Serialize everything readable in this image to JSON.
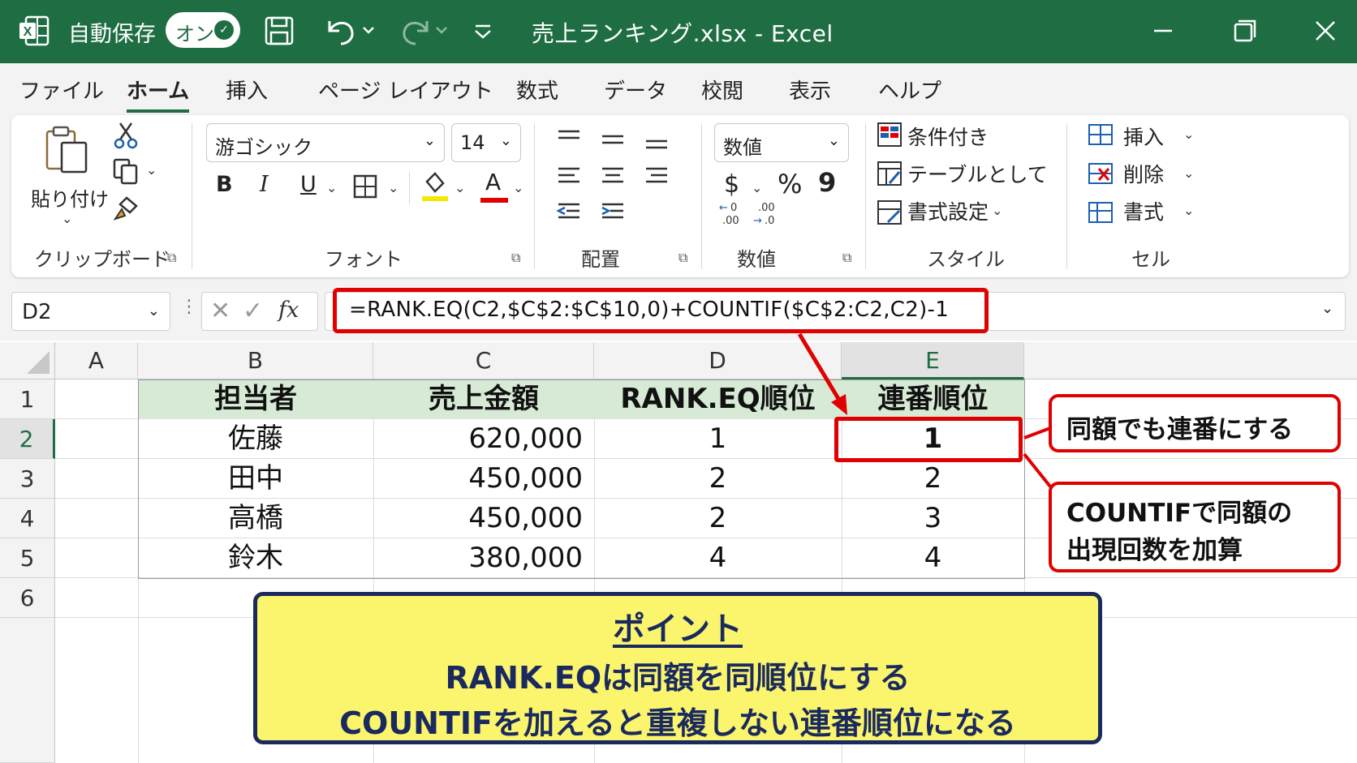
{
  "titlebar": {
    "autosave_label": "自動保存",
    "autosave_toggle": "オン",
    "document_title": "売上ランキング.xlsx  -  Excel",
    "accent_color": "#1f6e43"
  },
  "tabs": [
    "ファイル",
    "ホーム",
    "挿入",
    "ページ レイアウト",
    "数式",
    "データ",
    "校閲",
    "表示",
    "ヘルプ"
  ],
  "active_tab": "ホーム",
  "ribbon": {
    "clipboard": {
      "paste_label": "貼り付け",
      "group_label": "クリップボード"
    },
    "font": {
      "font_name": "游ゴシック",
      "font_size": "14",
      "bold": "B",
      "italic": "I",
      "underline": "U",
      "font_color_glyph": "A",
      "group_label": "フォント"
    },
    "alignment": {
      "group_label": "配置"
    },
    "number": {
      "format": "数値",
      "currency": "$",
      "percent": "%",
      "comma": "9",
      "inc_decimal": "←0\n.00",
      "dec_decimal": ".00\n→.0",
      "group_label": "数値"
    },
    "styles": {
      "conditional": "条件付き",
      "as_table": "テーブルとして",
      "cell_styles": "書式設定",
      "group_label": "スタイル"
    },
    "cells": {
      "insert": "挿入",
      "delete": "削除",
      "format": "書式",
      "group_label": "セル"
    }
  },
  "formula_bar": {
    "name_box": "D2",
    "fx": "fx",
    "formula": "=RANK.EQ(C2,$C$2:$C$10,0)+COUNTIF($C$2:C2,C2)-1"
  },
  "columns": [
    "A",
    "B",
    "C",
    "D",
    "E"
  ],
  "rows": [
    "1",
    "2",
    "3",
    "4",
    "5",
    "6"
  ],
  "table": {
    "headers": [
      "担当者",
      "売上金額",
      "RANK.EQ順位",
      "連番順位"
    ],
    "data": [
      [
        "佐藤",
        "620,000",
        "1",
        "1"
      ],
      [
        "田中",
        "450,000",
        "2",
        "2"
      ],
      [
        "高橋",
        "450,000",
        "2",
        "3"
      ],
      [
        "鈴木",
        "380,000",
        "4",
        "4"
      ]
    ]
  },
  "callouts": {
    "c1": "同額でも連番にする",
    "c2_line1": "COUNTIFで同額の",
    "c2_line2": "出現回数を加算"
  },
  "point": {
    "title": "ポイント",
    "line1": "RANK.EQは同額を同順位にする",
    "line2": "COUNTIFを加えると重複しない連番順位になる"
  },
  "colors": {
    "highlight_red": "#e00000",
    "header_green": "#d7ead5",
    "point_yellow": "#fbf56d",
    "point_navy": "#1a2a5e"
  }
}
